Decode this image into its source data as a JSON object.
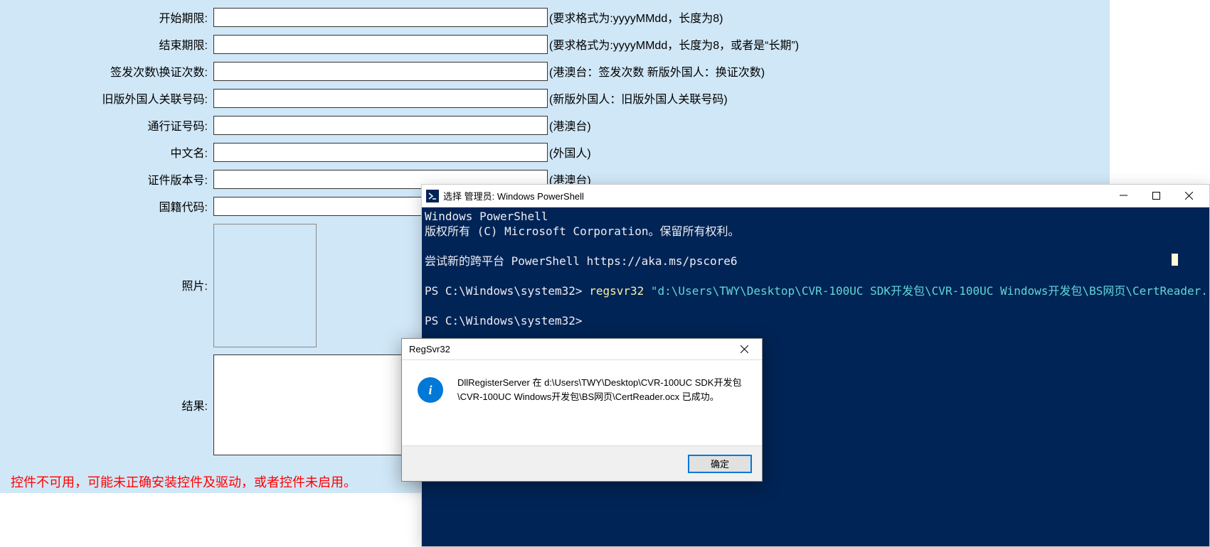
{
  "form": {
    "fields": [
      {
        "label": "开始期限:",
        "value": "",
        "hint": "(要求格式为:yyyyMMdd，长度为8)"
      },
      {
        "label": "结束期限:",
        "value": "",
        "hint": "(要求格式为:yyyyMMdd，长度为8，或者是“长期”)"
      },
      {
        "label": "签发次数\\换证次数:",
        "value": "",
        "hint": "(港澳台：签发次数 新版外国人：换证次数)"
      },
      {
        "label": "旧版外国人关联号码:",
        "value": "",
        "hint": "(新版外国人：旧版外国人关联号码)"
      },
      {
        "label": "通行证号码:",
        "value": "",
        "hint": "(港澳台)"
      },
      {
        "label": "中文名:",
        "value": "",
        "hint": "(外国人)"
      },
      {
        "label": "证件版本号:",
        "value": "",
        "hint": "(港澳台)"
      },
      {
        "label": "国籍代码:",
        "value": "",
        "hint": ""
      }
    ],
    "photoLabel": "照片:",
    "resultLabel": "结果:",
    "resultValue": "",
    "errorMsg": "控件不可用，可能未正确安装控件及驱动，或者控件未启用。"
  },
  "powershell": {
    "title": "选择 管理员: Windows PowerShell",
    "lines": {
      "l1": "Windows PowerShell",
      "l2": "版权所有 (C) Microsoft Corporation。保留所有权利。",
      "l3": "尝试新的跨平台 PowerShell https://aka.ms/pscore6",
      "prompt1_a": "PS C:\\Windows\\system32> ",
      "prompt1_cmd": "regsvr32 ",
      "prompt1_arg": "\"d:\\Users\\TWY\\Desktop\\CVR-100UC SDK开发包\\CVR-100UC Windows开发包\\BS网页\\CertReader.",
      "prompt2": "PS C:\\Windows\\system32>"
    }
  },
  "dialog": {
    "title": "RegSvr32",
    "message": "DllRegisterServer 在 d:\\Users\\TWY\\Desktop\\CVR-100UC SDK开发包\\CVR-100UC Windows开发包\\BS网页\\CertReader.ocx 已成功。",
    "okLabel": "确定"
  }
}
